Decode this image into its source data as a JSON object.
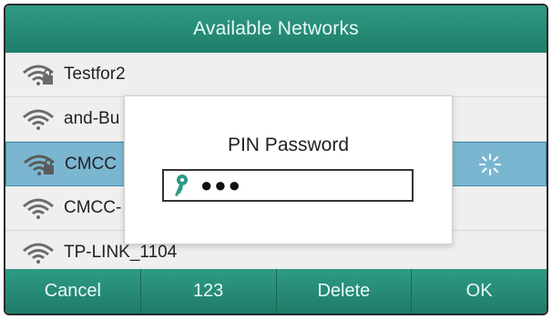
{
  "header": {
    "title": "Available Networks"
  },
  "networks": [
    {
      "ssid": "Testfor2",
      "icon": "wifi-locked-icon"
    },
    {
      "ssid": "and-Bu",
      "icon": "wifi-icon"
    },
    {
      "ssid": "CMCC",
      "icon": "wifi-locked-icon",
      "selected": true,
      "status_icon": "loading-spinner-icon"
    },
    {
      "ssid": "CMCC-",
      "icon": "wifi-icon"
    },
    {
      "ssid": "TP-LINK_1104",
      "icon": "wifi-icon"
    }
  ],
  "dialog": {
    "title": "PIN Password",
    "field_icon": "key-icon",
    "value_masked": "●●●"
  },
  "softkeys": [
    "Cancel",
    "123",
    "Delete",
    "OK"
  ],
  "colors": {
    "header": "#2a8f79",
    "selected_row": "#7bb6d1",
    "key_icon": "#2f9a83"
  }
}
